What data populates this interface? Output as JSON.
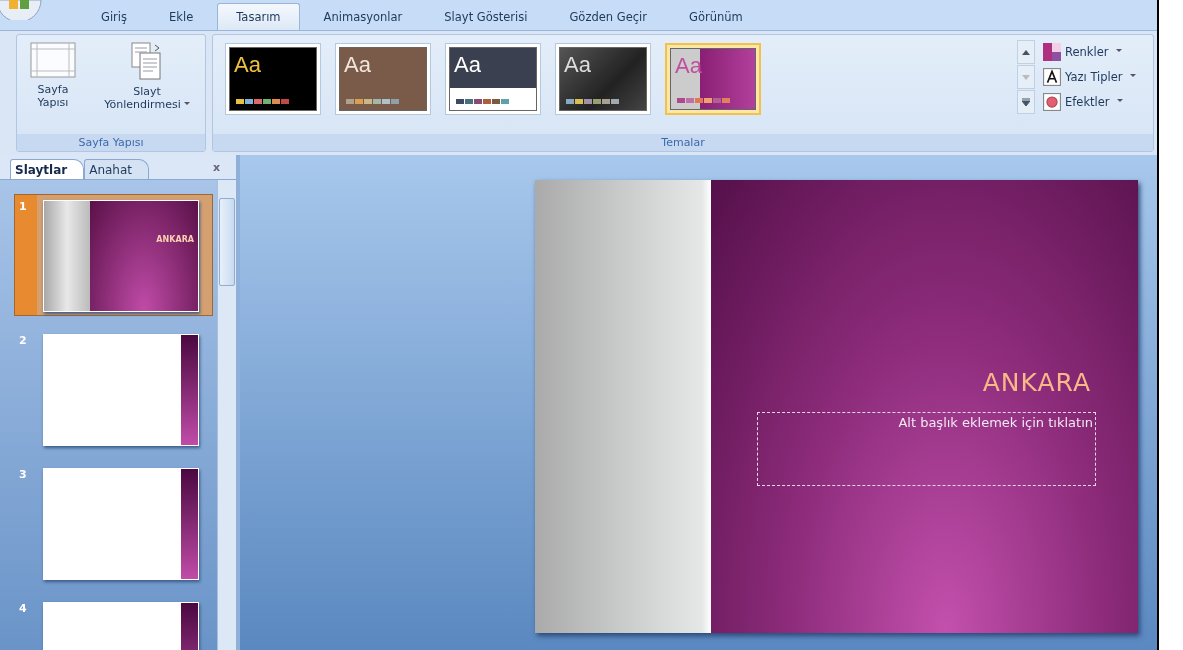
{
  "tabs": [
    {
      "label": "Giriş",
      "selected": false
    },
    {
      "label": "Ekle",
      "selected": false
    },
    {
      "label": "Tasarım",
      "selected": true
    },
    {
      "label": "Animasyonlar",
      "selected": false
    },
    {
      "label": "Slayt Gösterisi",
      "selected": false
    },
    {
      "label": "Gözden Geçir",
      "selected": false
    },
    {
      "label": "Görünüm",
      "selected": false
    }
  ],
  "ribbon": {
    "page_setup": {
      "label": "Sayfa Yapısı",
      "buttons": [
        {
          "kind": "page",
          "label": "Sayfa Yapısı",
          "dropdown": false
        },
        {
          "kind": "orientation",
          "label": "Slayt Yönlendirmesi",
          "dropdown": true
        }
      ]
    },
    "themes": {
      "label": "Temalar",
      "items": [
        {
          "kind": "dark",
          "label": "Aa",
          "selected": false
        },
        {
          "kind": "brown",
          "label": "Aa",
          "selected": false
        },
        {
          "kind": "light",
          "label": "Aa",
          "selected": false
        },
        {
          "kind": "graphite",
          "label": "Aa",
          "selected": false
        },
        {
          "kind": "purple",
          "label": "Aa",
          "selected": true
        }
      ],
      "options": [
        {
          "kind": "colors",
          "label": "Renkler"
        },
        {
          "kind": "fonts",
          "label": "Yazı Tipler"
        },
        {
          "kind": "effects",
          "label": "Efektler"
        }
      ]
    }
  },
  "slide_pane": {
    "tabs": [
      {
        "label": "Slaytlar",
        "selected": true
      },
      {
        "label": "Anahat",
        "selected": false
      }
    ],
    "close": "x",
    "slides": [
      {
        "number": "1",
        "kind": "title",
        "title": "ANKARA",
        "selected": true
      },
      {
        "number": "2",
        "kind": "blank",
        "selected": false
      },
      {
        "number": "3",
        "kind": "blank",
        "selected": false
      },
      {
        "number": "4",
        "kind": "blank",
        "selected": false
      }
    ]
  },
  "slide": {
    "title": "ANKARA",
    "subtitle_placeholder": "Alt başlık eklemek için tıklatın"
  }
}
